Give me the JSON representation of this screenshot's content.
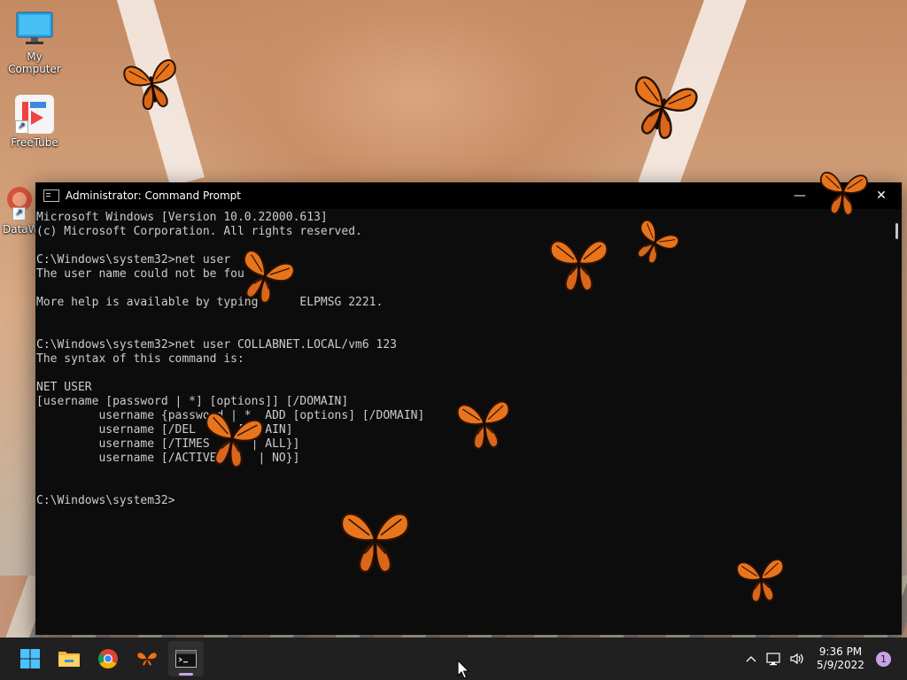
{
  "desktop": {
    "icons": [
      {
        "label": "My Computer"
      },
      {
        "label": "FreeTube"
      },
      {
        "label": "DataWi"
      }
    ]
  },
  "window": {
    "title": "Administrator: Command Prompt",
    "minimize_glyph": "—",
    "close_glyph": "✕"
  },
  "console": {
    "lines": [
      "Microsoft Windows [Version 10.0.22000.613]",
      "(c) Microsoft Corporation. All rights reserved.",
      "",
      "C:\\Windows\\system32>net user",
      "The user name could not be fou",
      "",
      "More help is available by typing      ELPMSG 2221.",
      "",
      "",
      "C:\\Windows\\system32>net user COLLABNET.LOCAL/vm6 123",
      "The syntax of this command is:",
      "",
      "NET USER",
      "[username [password | *] [options]] [/DOMAIN]",
      "         username {password | *  ADD [options] [/DOMAIN]",
      "         username [/DEL      [   AIN]",
      "         username [/TIMES      | ALL}]",
      "         username [/ACTIVE      | NO}]",
      "",
      "",
      "C:\\Windows\\system32>"
    ]
  },
  "taskbar": {
    "apps": [
      {
        "name": "Start",
        "icon": "windows-icon"
      },
      {
        "name": "File Explorer",
        "icon": "folder-icon"
      },
      {
        "name": "Chrome",
        "icon": "chrome-icon"
      },
      {
        "name": "Butterfly",
        "icon": "butterfly-icon"
      },
      {
        "name": "Command Prompt",
        "icon": "terminal-icon",
        "active": true
      }
    ],
    "tray": {
      "chevron": "^",
      "time": "9:36 PM",
      "date": "5/9/2022",
      "notifications": "1"
    }
  },
  "colors": {
    "console_text": "#cccccc",
    "console_bg": "#0c0c0c",
    "taskbar_bg": "#202020",
    "butterfly": "#e8741c",
    "accent": "#c8a2e8"
  }
}
